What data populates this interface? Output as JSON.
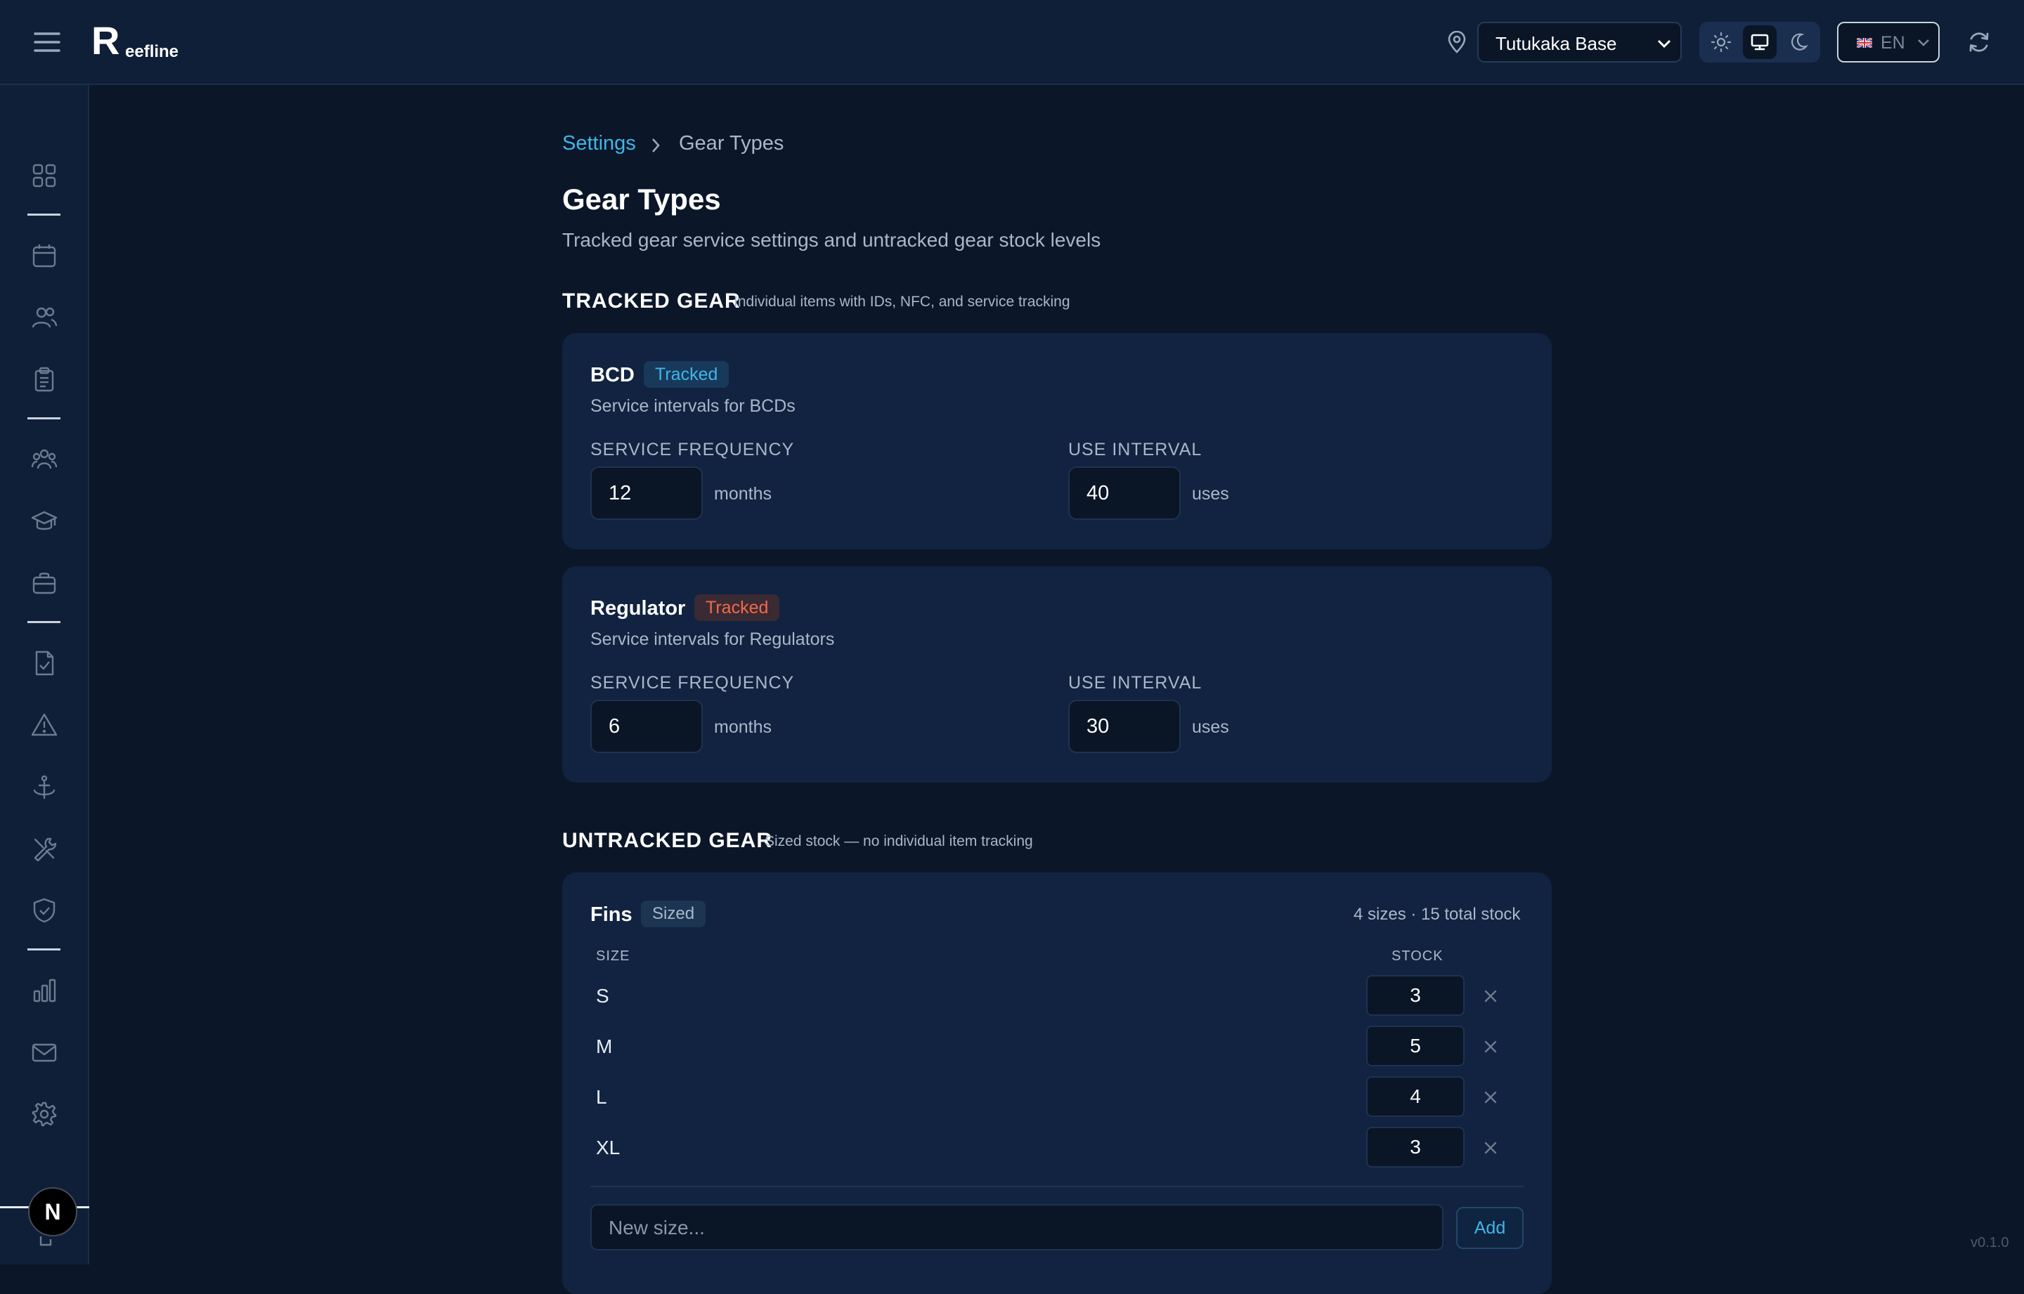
{
  "app": {
    "name": "Reefline",
    "logo_initial": "R",
    "logo_rest": "eefline",
    "version": "v0.1.0"
  },
  "header": {
    "location": "Tutukaka Base",
    "language": "EN",
    "theme_options": [
      "light",
      "system",
      "dark"
    ],
    "theme_selected": "system"
  },
  "breadcrumb": {
    "parent": "Settings",
    "current": "Gear Types"
  },
  "page": {
    "title": "Gear Types",
    "subtitle": "Tracked gear service settings and untracked gear stock levels"
  },
  "tracked": {
    "heading": "TRACKED GEAR",
    "note": "Individual items with IDs, NFC, and service tracking",
    "items": [
      {
        "name": "BCD",
        "badge": "Tracked",
        "badge_color": "#3fb6e8",
        "desc": "Service intervals for BCDs",
        "freq_label": "SERVICE FREQUENCY",
        "freq_value": "12",
        "freq_unit": "months",
        "use_label": "USE INTERVAL",
        "use_value": "40",
        "use_unit": "uses"
      },
      {
        "name": "Regulator",
        "badge": "Tracked",
        "badge_color": "#f06a4a",
        "desc": "Service intervals for Regulators",
        "freq_label": "SERVICE FREQUENCY",
        "freq_value": "6",
        "freq_unit": "months",
        "use_label": "USE INTERVAL",
        "use_value": "30",
        "use_unit": "uses"
      }
    ]
  },
  "untracked": {
    "heading": "UNTRACKED GEAR",
    "note": "Sized stock — no individual item tracking",
    "fins": {
      "name": "Fins",
      "badge": "Sized",
      "summary": "4 sizes · 15 total stock",
      "col_size": "SIZE",
      "col_stock": "STOCK",
      "rows": [
        {
          "size": "S",
          "stock": "3"
        },
        {
          "size": "M",
          "stock": "5"
        },
        {
          "size": "L",
          "stock": "4"
        },
        {
          "size": "XL",
          "stock": "3"
        }
      ],
      "new_placeholder": "New size...",
      "add_label": "Add"
    }
  },
  "dev_badge": "N",
  "colors": {
    "accent": "#3fb6e8",
    "regulator": "#f06a4a",
    "background": "#0b1628",
    "card": "#112340"
  }
}
